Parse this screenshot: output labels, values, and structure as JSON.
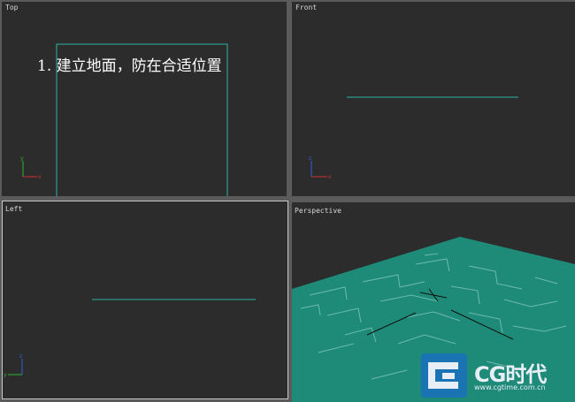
{
  "viewports": {
    "top": {
      "label": "Top"
    },
    "front": {
      "label": "Front"
    },
    "left": {
      "label": "Left"
    },
    "perspective": {
      "label": "Perspective"
    }
  },
  "annotation": "1. 建立地面，防在合适位置",
  "axes": {
    "x": "x",
    "y": "y",
    "z": "z"
  },
  "logo": {
    "name": "CG时代",
    "url": "www.cgtime.com.cn"
  },
  "colors": {
    "viewport_bg": "#2c2c2c",
    "border": "#5b5b5b",
    "plane": "#1e8a78",
    "plane_edge": "#2fb5a4",
    "axis_x": "#d03030",
    "axis_y": "#30b030",
    "axis_z": "#3060e0"
  }
}
